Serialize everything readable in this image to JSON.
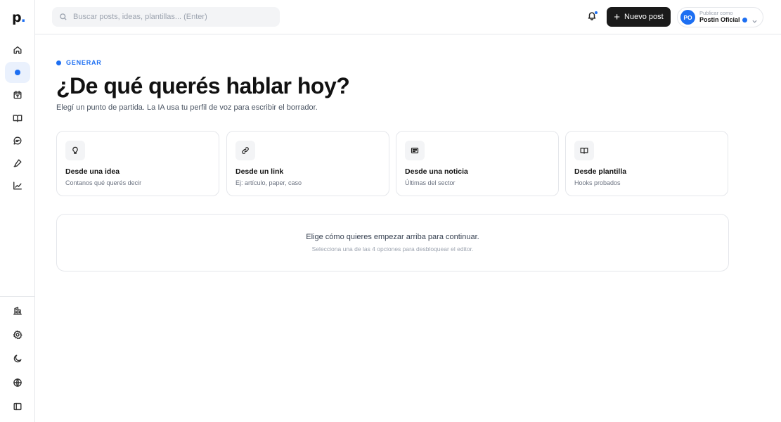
{
  "brand": {
    "logo_letter": "p",
    "logo_dot": "."
  },
  "sidebar": {
    "top_items": [
      {
        "name": "home",
        "icon": "home-icon"
      },
      {
        "name": "generate",
        "icon": "dot-icon",
        "active": true
      },
      {
        "name": "calendar",
        "icon": "calendar-icon"
      },
      {
        "name": "library",
        "icon": "book-icon"
      },
      {
        "name": "messages",
        "icon": "chat-icon"
      },
      {
        "name": "tools",
        "icon": "pen-icon"
      },
      {
        "name": "analytics",
        "icon": "chart-icon"
      }
    ],
    "bottom_items": [
      {
        "name": "organization",
        "icon": "building-icon"
      },
      {
        "name": "settings",
        "icon": "gear-icon"
      },
      {
        "name": "theme",
        "icon": "moon-icon"
      },
      {
        "name": "language",
        "icon": "globe-icon"
      },
      {
        "name": "collapse",
        "icon": "sidebar-icon"
      }
    ]
  },
  "header": {
    "search_placeholder": "Buscar posts, ideas, plantillas... (Enter)",
    "new_post_label": "Nuevo post",
    "account": {
      "initials": "PO",
      "caption": "Publicar como",
      "name": "Postin Oficial"
    }
  },
  "main": {
    "eyebrow": "GENERAR",
    "title": "¿De qué querés hablar hoy?",
    "subtitle": "Elegí un punto de partida. La IA usa tu perfil de voz para escribir el borrador.",
    "cards": [
      {
        "icon": "lightbulb-icon",
        "title": "Desde una idea",
        "desc": "Contanos qué querés decir"
      },
      {
        "icon": "link-icon",
        "title": "Desde un link",
        "desc": "Ej: artículo, paper, caso"
      },
      {
        "icon": "newspaper-icon",
        "title": "Desde una noticia",
        "desc": "Últimas del sector"
      },
      {
        "icon": "book-open-icon",
        "title": "Desde plantilla",
        "desc": "Hooks probados"
      }
    ],
    "empty_state": {
      "title": "Elige cómo quieres empezar arriba para continuar.",
      "desc": "Selecciona una de las 4 opciones para desbloquear el editor."
    }
  },
  "colors": {
    "accent": "#1d6ff2",
    "primary_button": "#1a1a1a"
  }
}
